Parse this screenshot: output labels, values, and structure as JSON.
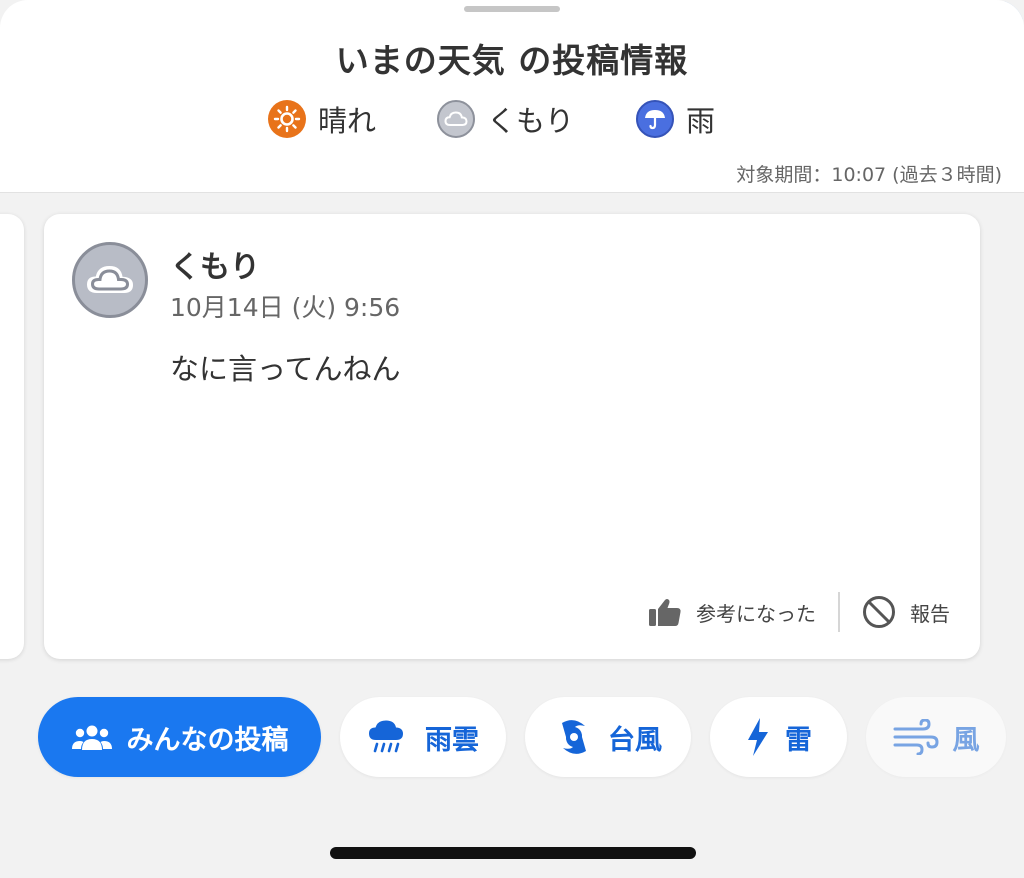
{
  "header": {
    "title": "いまの天気 の投稿情報",
    "period": "対象期間：10:07 (過去３時間)"
  },
  "legend": [
    {
      "label": "晴れ",
      "icon": "sunny-icon",
      "color": "#e8731a"
    },
    {
      "label": "くもり",
      "icon": "cloud-icon",
      "color": "#9a9ea8"
    },
    {
      "label": "雨",
      "icon": "umbrella-icon",
      "color": "#4a6fe0"
    }
  ],
  "post": {
    "weather": "くもり",
    "datetime": "10月14日 (火) 9:56",
    "body": "なに言ってんねん",
    "helpful_label": "参考になった",
    "report_label": "報告"
  },
  "tabs": [
    {
      "label": "みんなの投稿",
      "icon": "people-icon",
      "active": true
    },
    {
      "label": "雨雲",
      "icon": "rain-cloud-icon",
      "active": false
    },
    {
      "label": "台風",
      "icon": "typhoon-icon",
      "active": false
    },
    {
      "label": "雷",
      "icon": "lightning-icon",
      "active": false
    },
    {
      "label": "風",
      "icon": "wind-icon",
      "active": false
    }
  ],
  "colors": {
    "accent": "#1a78f0",
    "tab_text": "#1565d8"
  }
}
